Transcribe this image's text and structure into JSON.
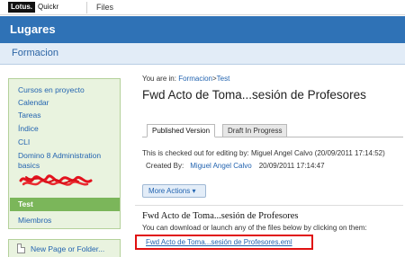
{
  "topbar": {
    "logo_brand": "Lotus.",
    "logo_product": "Quickr",
    "files_label": "Files"
  },
  "banner": {
    "title": "Lugares"
  },
  "place": {
    "title": "Formacion"
  },
  "sidebar": {
    "items": [
      {
        "label": "Cursos en proyecto"
      },
      {
        "label": "Calendar"
      },
      {
        "label": "Tareas"
      },
      {
        "label": "Índice"
      },
      {
        "label": "CLI"
      },
      {
        "label": "Domino 8 Administration"
      },
      {
        "label": "basics"
      },
      {
        "label": "Test"
      },
      {
        "label": "Miembros"
      }
    ],
    "new_page_label": "New Page or Folder..."
  },
  "breadcrumb": {
    "prefix": "You are in:",
    "place": "Formacion",
    "separator": ">",
    "current": "Test"
  },
  "page": {
    "title": "Fwd Acto de Toma...sesión de Profesores"
  },
  "tabs": [
    {
      "label": "Published Version"
    },
    {
      "label": "Draft In Progress"
    }
  ],
  "status": {
    "checkout_text": "This is checked out for editing by: Miguel Angel Calvo (20/09/2011 17:14:52)",
    "created_label": "Created By:",
    "created_author": "Miguel Angel Calvo",
    "created_date": "20/09/2011 17:14:47"
  },
  "actions": {
    "more_actions_label": "More Actions ▾"
  },
  "document": {
    "title": "Fwd Acto de Toma...sesión de Profesores",
    "instructions": "You can download or launch any of the files below by clicking on them:",
    "attachment": "Fwd Acto de Toma...sesión de Profesores.eml"
  },
  "colors": {
    "banner": "#2f72b6",
    "sidebar_bg": "#e9f3df",
    "selected": "#7bb65a",
    "link": "#2364b0",
    "highlight": "#e01010"
  }
}
